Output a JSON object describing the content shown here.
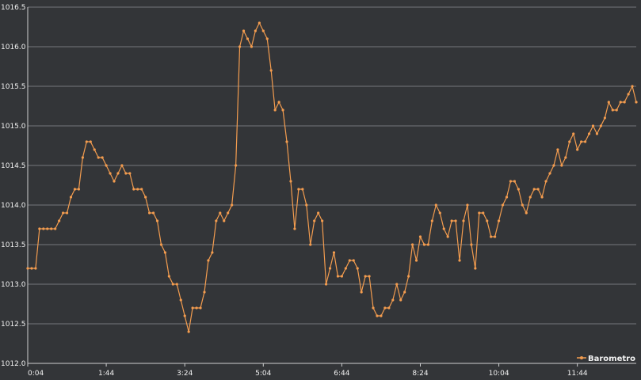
{
  "chart_data": {
    "type": "line",
    "title": "",
    "xlabel": "",
    "ylabel": "",
    "ylim": [
      1012.0,
      1016.5
    ],
    "y_ticks": [
      "1012.0",
      "1012.5",
      "1013.0",
      "1013.5",
      "1014.0",
      "1014.5",
      "1015.0",
      "1015.5",
      "1016.0",
      "1016.5"
    ],
    "x_ticks": [
      "0:04",
      "1:44",
      "3:24",
      "5:04",
      "6:44",
      "8:24",
      "10:04",
      "11:44"
    ],
    "grid": true,
    "legend_position": "bottom-right",
    "series": [
      {
        "name": "Barometro",
        "color": "#f39c4f",
        "values": [
          1013.2,
          1013.2,
          1013.2,
          1013.7,
          1013.7,
          1013.7,
          1013.7,
          1013.7,
          1013.8,
          1013.9,
          1013.9,
          1014.1,
          1014.2,
          1014.2,
          1014.6,
          1014.8,
          1014.8,
          1014.7,
          1014.6,
          1014.6,
          1014.5,
          1014.4,
          1014.3,
          1014.4,
          1014.5,
          1014.4,
          1014.4,
          1014.2,
          1014.2,
          1014.2,
          1014.1,
          1013.9,
          1013.9,
          1013.8,
          1013.5,
          1013.4,
          1013.1,
          1013.0,
          1013.0,
          1012.8,
          1012.6,
          1012.4,
          1012.7,
          1012.7,
          1012.7,
          1012.9,
          1013.3,
          1013.4,
          1013.8,
          1013.9,
          1013.8,
          1013.9,
          1014.0,
          1014.5,
          1016.0,
          1016.2,
          1016.1,
          1016.0,
          1016.2,
          1016.3,
          1016.2,
          1016.1,
          1015.7,
          1015.2,
          1015.3,
          1015.2,
          1014.8,
          1014.3,
          1013.7,
          1014.2,
          1014.2,
          1014.0,
          1013.5,
          1013.8,
          1013.9,
          1013.8,
          1013.0,
          1013.2,
          1013.4,
          1013.1,
          1013.1,
          1013.2,
          1013.3,
          1013.3,
          1013.2,
          1012.9,
          1013.1,
          1013.1,
          1012.7,
          1012.6,
          1012.6,
          1012.7,
          1012.7,
          1012.8,
          1013.0,
          1012.8,
          1012.9,
          1013.1,
          1013.5,
          1013.3,
          1013.6,
          1013.5,
          1013.5,
          1013.8,
          1014.0,
          1013.9,
          1013.7,
          1013.6,
          1013.8,
          1013.8,
          1013.3,
          1013.8,
          1014.0,
          1013.5,
          1013.2,
          1013.9,
          1013.9,
          1013.8,
          1013.6,
          1013.6,
          1013.8,
          1014.0,
          1014.1,
          1014.3,
          1014.3,
          1014.2,
          1014.0,
          1013.9,
          1014.1,
          1014.2,
          1014.2,
          1014.1,
          1014.3,
          1014.4,
          1014.5,
          1014.7,
          1014.5,
          1014.6,
          1014.8,
          1014.9,
          1014.7,
          1014.8,
          1014.8,
          1014.9,
          1015.0,
          1014.9,
          1015.0,
          1015.1,
          1015.3,
          1015.2,
          1015.2,
          1015.3,
          1015.3,
          1015.4,
          1015.5,
          1015.3
        ]
      }
    ]
  }
}
